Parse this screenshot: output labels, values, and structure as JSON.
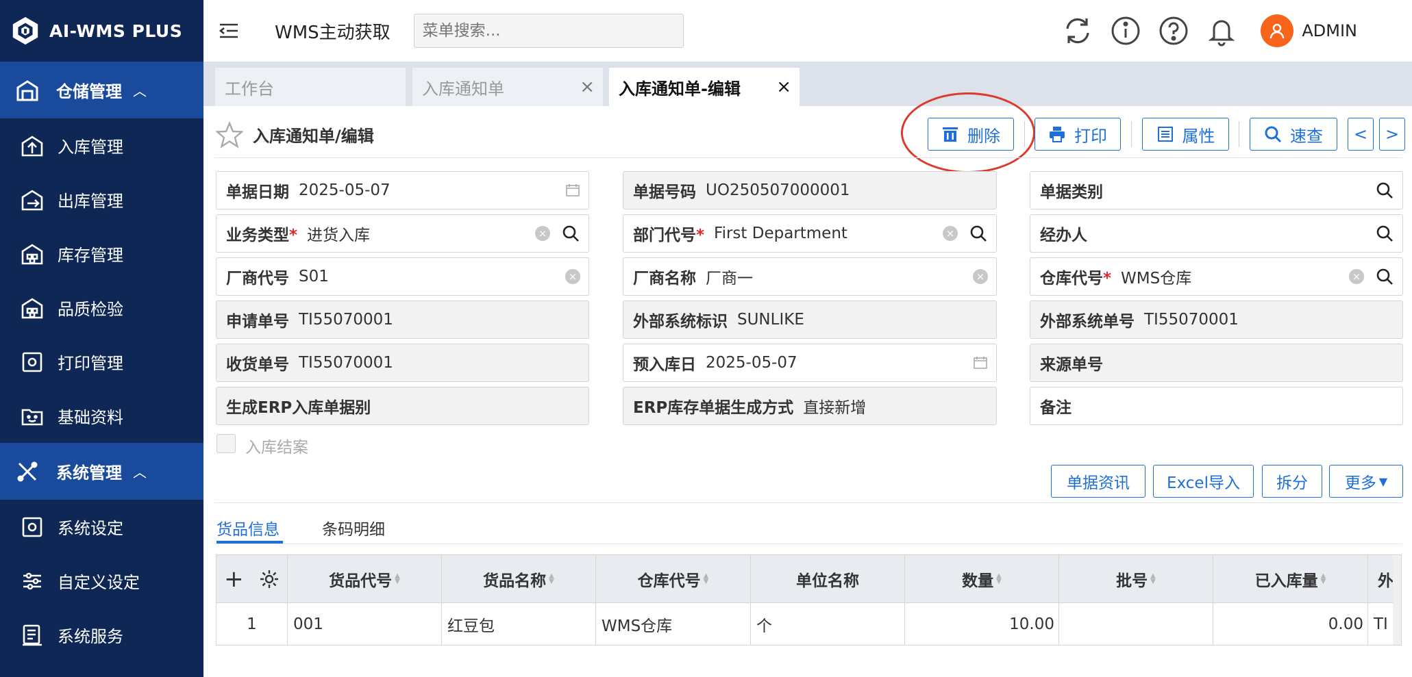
{
  "app": {
    "name": "AI-WMS PLUS"
  },
  "sidebar": {
    "groups": [
      {
        "label": "仓储管理",
        "items": [
          "入库管理",
          "出库管理",
          "库存管理",
          "品质检验",
          "打印管理",
          "基础资料"
        ]
      },
      {
        "label": "系统管理",
        "items": [
          "系统设定",
          "自定义设定",
          "系统服务"
        ]
      }
    ]
  },
  "header": {
    "title": "WMS主动获取",
    "search_placeholder": "菜单搜索...",
    "user": "ADMIN"
  },
  "tabs": [
    {
      "label": "工作台"
    },
    {
      "label": "入库通知单"
    },
    {
      "label": "入库通知单-编辑"
    }
  ],
  "toolbar": {
    "breadcrumb": "入库通知单/编辑",
    "delete": "删除",
    "print": "打印",
    "props": "属性",
    "quick": "速查",
    "prev": "<",
    "next": ">"
  },
  "form": {
    "doc_date": {
      "label": "单据日期",
      "value": "2025-05-07"
    },
    "doc_no": {
      "label": "单据号码",
      "value": "UO250507000001"
    },
    "doc_type": {
      "label": "单据类别",
      "value": ""
    },
    "biz_type": {
      "label": "业务类型",
      "value": "进货入库"
    },
    "dept": {
      "label": "部门代号",
      "value": "First Department"
    },
    "handler": {
      "label": "经办人",
      "value": ""
    },
    "vendor_code": {
      "label": "厂商代号",
      "value": "S01"
    },
    "vendor_name": {
      "label": "厂商名称",
      "value": "厂商一"
    },
    "warehouse": {
      "label": "仓库代号",
      "value": "WMS仓库"
    },
    "apply_no": {
      "label": "申请单号",
      "value": "TI55070001"
    },
    "ext_sys": {
      "label": "外部系统标识",
      "value": "SUNLIKE"
    },
    "ext_no": {
      "label": "外部系统单号",
      "value": "TI55070001"
    },
    "recv_no": {
      "label": "收货单号",
      "value": "TI55070001"
    },
    "pre_date": {
      "label": "预入库日",
      "value": "2025-05-07"
    },
    "source_no": {
      "label": "来源单号",
      "value": ""
    },
    "gen_erp": {
      "label": "生成ERP入库单据别",
      "value": ""
    },
    "erp_mode": {
      "label": "ERP库存单据生成方式",
      "value": "直接新增"
    },
    "remark": {
      "label": "备注",
      "value": ""
    },
    "closed_label": "入库结案"
  },
  "actions": {
    "doc_info": "单据资讯",
    "excel": "Excel导入",
    "split": "拆分",
    "more": "更多"
  },
  "detail_tabs": [
    "货品信息",
    "条码明细"
  ],
  "grid": {
    "columns": [
      "货品代号",
      "货品名称",
      "仓库代号",
      "单位名称",
      "数量",
      "批号",
      "已入库量",
      "外"
    ],
    "rows": [
      {
        "idx": "1",
        "code": "001",
        "name": "红豆包",
        "wh": "WMS仓库",
        "unit": "个",
        "qty": "10.00",
        "lot": "",
        "in_qty": "0.00",
        "ext": "TI"
      }
    ]
  }
}
